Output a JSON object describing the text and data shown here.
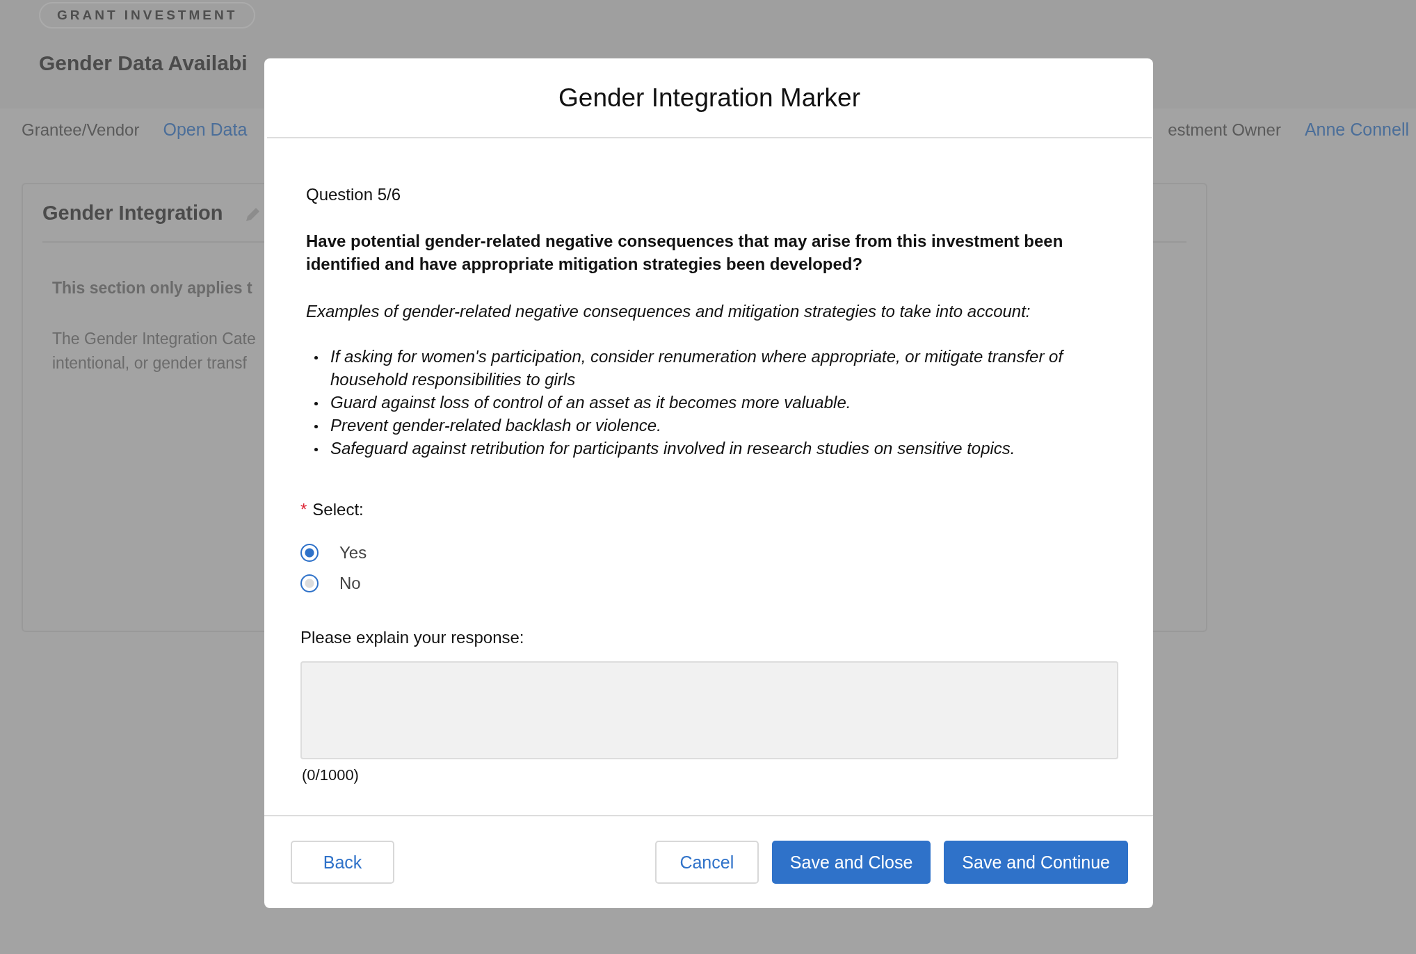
{
  "page": {
    "badge": "GRANT INVESTMENT",
    "title": "Gender Data Availabi",
    "fields": [
      {
        "label": "Grantee/Vendor",
        "value": "Open Data"
      },
      {
        "label": "estment Owner",
        "value": "Anne Connell"
      }
    ],
    "card": {
      "title": "Gender Integration",
      "notice": "This section only applies t",
      "description_lines": [
        "The Gender Integration Cate",
        "intentional, or gender transf"
      ]
    }
  },
  "modal": {
    "title": "Gender Integration Marker",
    "progress": "Question 5/6",
    "question": "Have potential gender-related negative consequences that may arise from this investment been identified and have appropriate mitigation strategies been developed?",
    "examples_intro": "Examples of gender-related negative consequences and mitigation strategies to take into account:",
    "examples": [
      "If asking for women's participation, consider renumeration where appropriate, or mitigate transfer of household responsibilities to girls",
      "Guard against loss of control of an asset as it becomes more valuable.",
      "Prevent gender-related backlash or violence.",
      "Safeguard against retribution for participants involved in research studies on sensitive topics."
    ],
    "select": {
      "label": "Select:",
      "required_mark": "*",
      "options": [
        {
          "label": "Yes",
          "selected": true
        },
        {
          "label": "No",
          "selected": false
        }
      ]
    },
    "explain": {
      "label": "Please explain your response:",
      "counter": "(0/1000)"
    },
    "buttons": [
      {
        "label": "Back",
        "kind": "secondary"
      },
      {
        "label": "Cancel",
        "kind": "secondary"
      },
      {
        "label": "Save and Close",
        "kind": "primary"
      },
      {
        "label": "Save and Continue",
        "kind": "primary"
      }
    ]
  }
}
